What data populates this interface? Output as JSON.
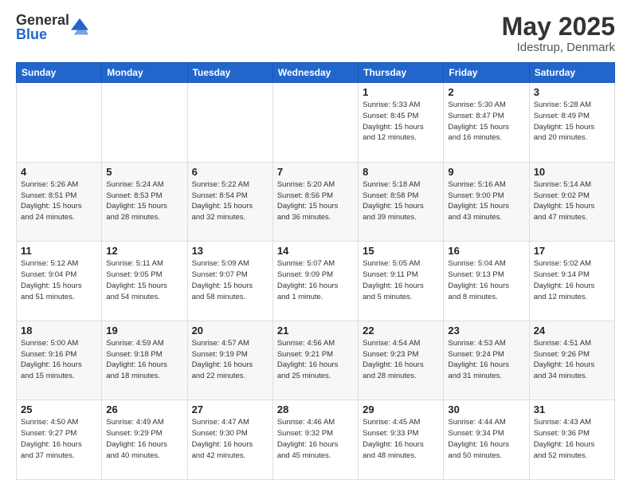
{
  "header": {
    "logo_general": "General",
    "logo_blue": "Blue",
    "month_title": "May 2025",
    "location": "Idestrup, Denmark"
  },
  "weekdays": [
    "Sunday",
    "Monday",
    "Tuesday",
    "Wednesday",
    "Thursday",
    "Friday",
    "Saturday"
  ],
  "weeks": [
    [
      {
        "day": "",
        "info": ""
      },
      {
        "day": "",
        "info": ""
      },
      {
        "day": "",
        "info": ""
      },
      {
        "day": "",
        "info": ""
      },
      {
        "day": "1",
        "info": "Sunrise: 5:33 AM\nSunset: 8:45 PM\nDaylight: 15 hours\nand 12 minutes."
      },
      {
        "day": "2",
        "info": "Sunrise: 5:30 AM\nSunset: 8:47 PM\nDaylight: 15 hours\nand 16 minutes."
      },
      {
        "day": "3",
        "info": "Sunrise: 5:28 AM\nSunset: 8:49 PM\nDaylight: 15 hours\nand 20 minutes."
      }
    ],
    [
      {
        "day": "4",
        "info": "Sunrise: 5:26 AM\nSunset: 8:51 PM\nDaylight: 15 hours\nand 24 minutes."
      },
      {
        "day": "5",
        "info": "Sunrise: 5:24 AM\nSunset: 8:53 PM\nDaylight: 15 hours\nand 28 minutes."
      },
      {
        "day": "6",
        "info": "Sunrise: 5:22 AM\nSunset: 8:54 PM\nDaylight: 15 hours\nand 32 minutes."
      },
      {
        "day": "7",
        "info": "Sunrise: 5:20 AM\nSunset: 8:56 PM\nDaylight: 15 hours\nand 36 minutes."
      },
      {
        "day": "8",
        "info": "Sunrise: 5:18 AM\nSunset: 8:58 PM\nDaylight: 15 hours\nand 39 minutes."
      },
      {
        "day": "9",
        "info": "Sunrise: 5:16 AM\nSunset: 9:00 PM\nDaylight: 15 hours\nand 43 minutes."
      },
      {
        "day": "10",
        "info": "Sunrise: 5:14 AM\nSunset: 9:02 PM\nDaylight: 15 hours\nand 47 minutes."
      }
    ],
    [
      {
        "day": "11",
        "info": "Sunrise: 5:12 AM\nSunset: 9:04 PM\nDaylight: 15 hours\nand 51 minutes."
      },
      {
        "day": "12",
        "info": "Sunrise: 5:11 AM\nSunset: 9:05 PM\nDaylight: 15 hours\nand 54 minutes."
      },
      {
        "day": "13",
        "info": "Sunrise: 5:09 AM\nSunset: 9:07 PM\nDaylight: 15 hours\nand 58 minutes."
      },
      {
        "day": "14",
        "info": "Sunrise: 5:07 AM\nSunset: 9:09 PM\nDaylight: 16 hours\nand 1 minute."
      },
      {
        "day": "15",
        "info": "Sunrise: 5:05 AM\nSunset: 9:11 PM\nDaylight: 16 hours\nand 5 minutes."
      },
      {
        "day": "16",
        "info": "Sunrise: 5:04 AM\nSunset: 9:13 PM\nDaylight: 16 hours\nand 8 minutes."
      },
      {
        "day": "17",
        "info": "Sunrise: 5:02 AM\nSunset: 9:14 PM\nDaylight: 16 hours\nand 12 minutes."
      }
    ],
    [
      {
        "day": "18",
        "info": "Sunrise: 5:00 AM\nSunset: 9:16 PM\nDaylight: 16 hours\nand 15 minutes."
      },
      {
        "day": "19",
        "info": "Sunrise: 4:59 AM\nSunset: 9:18 PM\nDaylight: 16 hours\nand 18 minutes."
      },
      {
        "day": "20",
        "info": "Sunrise: 4:57 AM\nSunset: 9:19 PM\nDaylight: 16 hours\nand 22 minutes."
      },
      {
        "day": "21",
        "info": "Sunrise: 4:56 AM\nSunset: 9:21 PM\nDaylight: 16 hours\nand 25 minutes."
      },
      {
        "day": "22",
        "info": "Sunrise: 4:54 AM\nSunset: 9:23 PM\nDaylight: 16 hours\nand 28 minutes."
      },
      {
        "day": "23",
        "info": "Sunrise: 4:53 AM\nSunset: 9:24 PM\nDaylight: 16 hours\nand 31 minutes."
      },
      {
        "day": "24",
        "info": "Sunrise: 4:51 AM\nSunset: 9:26 PM\nDaylight: 16 hours\nand 34 minutes."
      }
    ],
    [
      {
        "day": "25",
        "info": "Sunrise: 4:50 AM\nSunset: 9:27 PM\nDaylight: 16 hours\nand 37 minutes."
      },
      {
        "day": "26",
        "info": "Sunrise: 4:49 AM\nSunset: 9:29 PM\nDaylight: 16 hours\nand 40 minutes."
      },
      {
        "day": "27",
        "info": "Sunrise: 4:47 AM\nSunset: 9:30 PM\nDaylight: 16 hours\nand 42 minutes."
      },
      {
        "day": "28",
        "info": "Sunrise: 4:46 AM\nSunset: 9:32 PM\nDaylight: 16 hours\nand 45 minutes."
      },
      {
        "day": "29",
        "info": "Sunrise: 4:45 AM\nSunset: 9:33 PM\nDaylight: 16 hours\nand 48 minutes."
      },
      {
        "day": "30",
        "info": "Sunrise: 4:44 AM\nSunset: 9:34 PM\nDaylight: 16 hours\nand 50 minutes."
      },
      {
        "day": "31",
        "info": "Sunrise: 4:43 AM\nSunset: 9:36 PM\nDaylight: 16 hours\nand 52 minutes."
      }
    ]
  ]
}
